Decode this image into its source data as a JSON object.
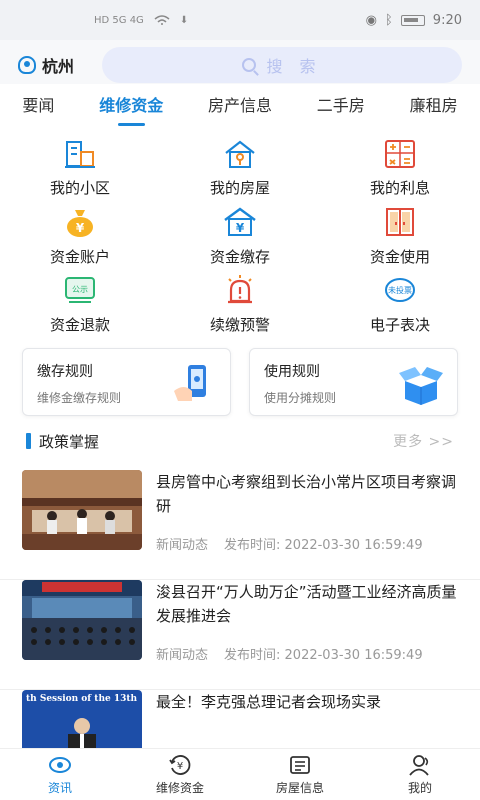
{
  "status_bar": {
    "left_indicators": "HD 5G  4G",
    "time": "9:20"
  },
  "header": {
    "city": "杭州",
    "search_placeholder": "搜 索"
  },
  "tabs": [
    {
      "label": "要闻",
      "active": false
    },
    {
      "label": "维修资金",
      "active": true
    },
    {
      "label": "房产信息",
      "active": false
    },
    {
      "label": "二手房",
      "active": false
    },
    {
      "label": "廉租房",
      "active": false
    }
  ],
  "grid_items": [
    {
      "label": "我的小区",
      "icon": "building-icon"
    },
    {
      "label": "我的房屋",
      "icon": "house-icon"
    },
    {
      "label": "我的利息",
      "icon": "calculator-icon"
    },
    {
      "label": "资金账户",
      "icon": "money-bag-icon"
    },
    {
      "label": "资金缴存",
      "icon": "deposit-house-icon"
    },
    {
      "label": "资金使用",
      "icon": "doors-icon"
    },
    {
      "label": "资金退款",
      "icon": "public-notice-icon"
    },
    {
      "label": "续缴预警",
      "icon": "alarm-icon"
    },
    {
      "label": "电子表决",
      "icon": "vote-icon"
    }
  ],
  "rule_cards": [
    {
      "title": "缴存规则",
      "subtitle": "维修金缴存规则",
      "icon": "phone-hand-icon"
    },
    {
      "title": "使用规则",
      "subtitle": "使用分摊规则",
      "icon": "open-box-icon"
    }
  ],
  "section": {
    "title": "政策掌握",
    "more": "更多 >>"
  },
  "news": [
    {
      "title": "县房管中心考察组到长治小常片区项目考察调研",
      "category": "新闻动态",
      "time": "发布时间: 2022-03-30 16:59:49"
    },
    {
      "title": "浚县召开“万人助万企”活动暨工业经济高质量发展推进会",
      "category": "新闻动态",
      "time": "发布时间: 2022-03-30 16:59:49"
    },
    {
      "title": "最全！李克强总理记者会现场实录",
      "banner_text": "th Session of the 13th"
    }
  ],
  "bottom_nav": [
    {
      "label": "资讯",
      "icon": "eye-icon",
      "active": true
    },
    {
      "label": "维修资金",
      "icon": "yuan-circle-icon",
      "active": false
    },
    {
      "label": "房屋信息",
      "icon": "house-card-icon",
      "active": false
    },
    {
      "label": "我的",
      "icon": "user-icon",
      "active": false
    }
  ],
  "colors": {
    "accent": "#1a86d8",
    "orange": "#f08a24",
    "green": "#2bb673",
    "red": "#e04a3a"
  }
}
